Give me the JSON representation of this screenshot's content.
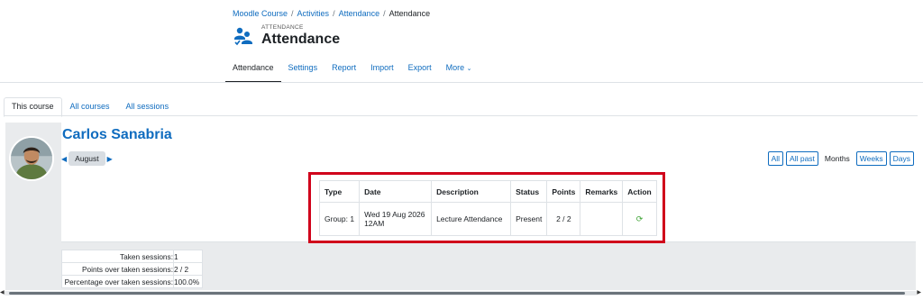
{
  "breadcrumb": {
    "items": [
      "Moodle Course",
      "Activities",
      "Attendance"
    ],
    "current": "Attendance",
    "separator": "/"
  },
  "header": {
    "pretitle": "ATTENDANCE",
    "title": "Attendance",
    "icon": "attendance-icon"
  },
  "secondary_nav": {
    "tabs": [
      "Attendance",
      "Settings",
      "Report",
      "Import",
      "Export",
      "More"
    ],
    "active": "Attendance"
  },
  "view_tabs": {
    "tabs": [
      "This course",
      "All courses",
      "All sessions"
    ],
    "active": "This course"
  },
  "user": {
    "name": "Carlos Sanabria",
    "avatar": "avatar-photo"
  },
  "month_nav": {
    "month": "August",
    "prev_icon": "triangle-left-icon",
    "next_icon": "triangle-right-icon"
  },
  "view_buttons": [
    "All",
    "All past",
    "Months",
    "Weeks",
    "Days"
  ],
  "sessions_table": {
    "headers": [
      "Type",
      "Date",
      "Description",
      "Status",
      "Points",
      "Remarks",
      "Action"
    ],
    "rows": [
      {
        "type": "Group: 1",
        "date": "Wed 19 Aug 2026 12AM",
        "description": "Lecture Attendance",
        "status": "Present",
        "points": "2 / 2",
        "remarks": "",
        "action_icon": "refresh-icon"
      }
    ]
  },
  "summary": [
    {
      "label": "Taken sessions:",
      "value": "1"
    },
    {
      "label": "Points over taken sessions:",
      "value": "2 / 2"
    },
    {
      "label": "Percentage over taken sessions:",
      "value": "100.0%"
    }
  ],
  "colors": {
    "link": "#0f6cbf",
    "highlight_border": "#d0021b",
    "panel_bg": "#e9ebed"
  }
}
